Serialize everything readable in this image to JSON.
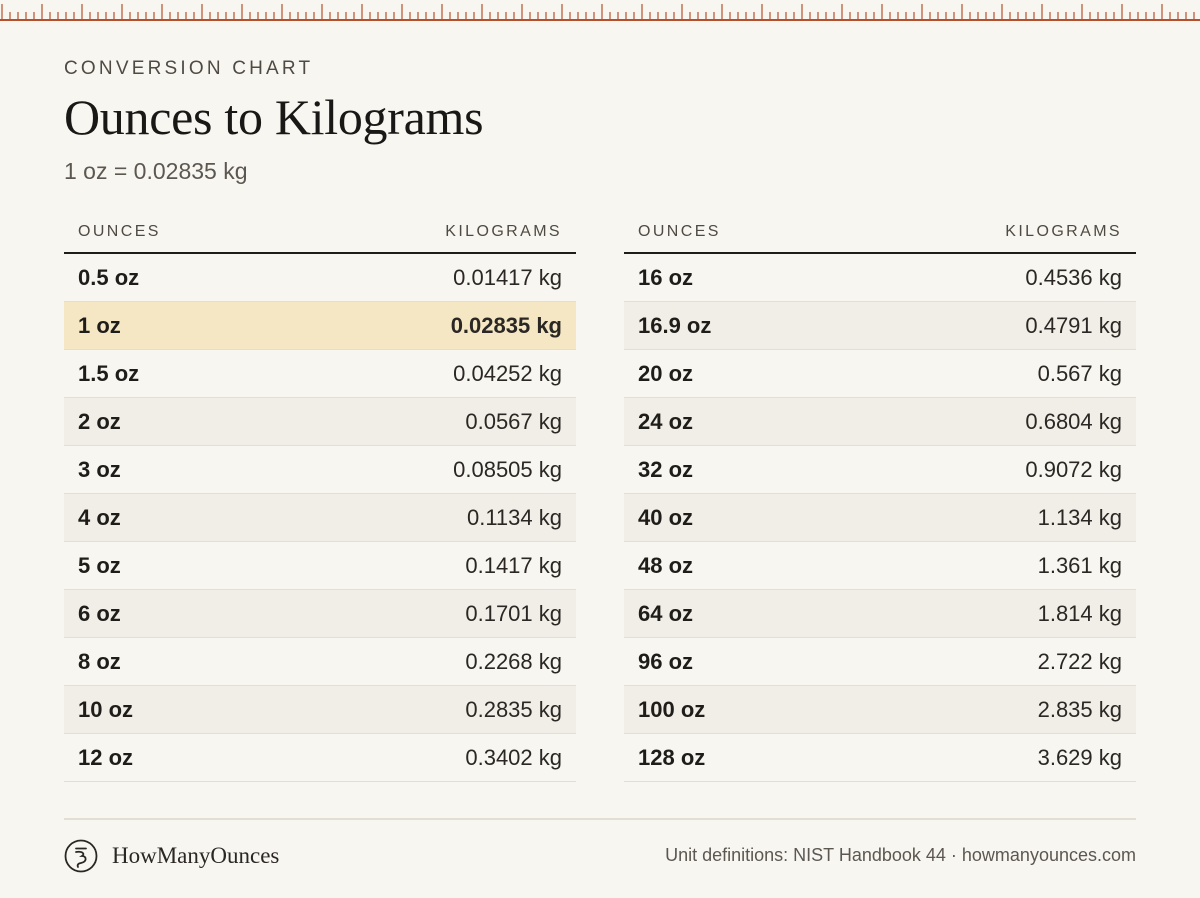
{
  "header": {
    "eyebrow": "CONVERSION CHART",
    "title": "Ounces to Kilograms",
    "subtitle": "1 oz = 0.02835 kg"
  },
  "colors": {
    "background": "#f8f6f1",
    "ruler": "#b5502a",
    "highlight": "#f5e7c4",
    "stripe": "#f1eee7"
  },
  "table_left": {
    "col_ounces": "OUNCES",
    "col_kilograms": "KILOGRAMS",
    "rows": [
      {
        "oz": "0.5 oz",
        "kg": "0.01417 kg"
      },
      {
        "oz": "1 oz",
        "kg": "0.02835 kg"
      },
      {
        "oz": "1.5 oz",
        "kg": "0.04252 kg"
      },
      {
        "oz": "2 oz",
        "kg": "0.0567 kg"
      },
      {
        "oz": "3 oz",
        "kg": "0.08505 kg"
      },
      {
        "oz": "4 oz",
        "kg": "0.1134 kg"
      },
      {
        "oz": "5 oz",
        "kg": "0.1417 kg"
      },
      {
        "oz": "6 oz",
        "kg": "0.1701 kg"
      },
      {
        "oz": "8 oz",
        "kg": "0.2268 kg"
      },
      {
        "oz": "10 oz",
        "kg": "0.2835 kg"
      },
      {
        "oz": "12 oz",
        "kg": "0.3402 kg"
      }
    ]
  },
  "table_right": {
    "col_ounces": "OUNCES",
    "col_kilograms": "KILOGRAMS",
    "rows": [
      {
        "oz": "16 oz",
        "kg": "0.4536 kg"
      },
      {
        "oz": "16.9 oz",
        "kg": "0.4791 kg"
      },
      {
        "oz": "20 oz",
        "kg": "0.567 kg"
      },
      {
        "oz": "24 oz",
        "kg": "0.6804 kg"
      },
      {
        "oz": "32 oz",
        "kg": "0.9072 kg"
      },
      {
        "oz": "40 oz",
        "kg": "1.134 kg"
      },
      {
        "oz": "48 oz",
        "kg": "1.361 kg"
      },
      {
        "oz": "64 oz",
        "kg": "1.814 kg"
      },
      {
        "oz": "96 oz",
        "kg": "2.722 kg"
      },
      {
        "oz": "100 oz",
        "kg": "2.835 kg"
      },
      {
        "oz": "128 oz",
        "kg": "3.629 kg"
      }
    ]
  },
  "footer": {
    "brand_icon": "ounce-glyph-icon",
    "brand_name": "HowManyOunces",
    "source": "Unit definitions: NIST Handbook 44 · howmanyounces.com"
  }
}
